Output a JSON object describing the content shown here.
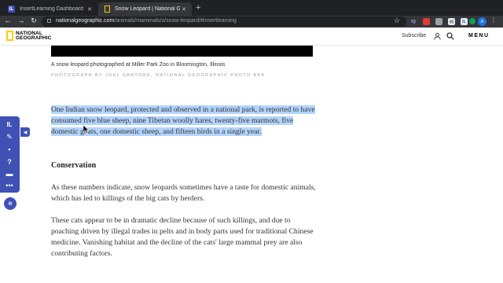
{
  "browser": {
    "tabs": [
      {
        "title": "InsertLearning Dashboard",
        "favicon": "IL",
        "active": false
      },
      {
        "title": "Snow Leopard | National Geographic",
        "favicon": "natgeo-logo-icon",
        "active": true
      }
    ],
    "new_tab_label": "+",
    "url_host": "nationalgeographic.com",
    "url_path": "/animals/mammals/s/snow-leopard/#insertlearning",
    "extensions": [
      {
        "name": "iq-extension-icon",
        "label": "IQ",
        "color": "#5b8def"
      },
      {
        "name": "red-extension-icon",
        "label": "●",
        "color": "#e53935"
      },
      {
        "name": "grey-extension-icon",
        "label": "▪",
        "color": "#5f6368"
      },
      {
        "name": "docs-extension-icon",
        "label": "▤",
        "color": "#5f6368"
      },
      {
        "name": "insertlearning-extension-icon",
        "label": "IL",
        "color": "#3f51b5"
      },
      {
        "name": "green-extension-icon",
        "label": "G",
        "color": "#0f9d58"
      },
      {
        "name": "puzzle-extension-icon",
        "label": "◆",
        "color": "#5f6368"
      }
    ],
    "profile_initial": "A"
  },
  "site": {
    "logo_line1": "NATIONAL",
    "logo_line2": "GEOGRAPHIC",
    "subscribe": "Subscribe",
    "menu": "MENU"
  },
  "article": {
    "caption": "A snow leopard photographed at Miller Park Zoo in Bloomington, Illinois",
    "credit": "PHOTOGRAPH BY JOEL SARTORE, NATIONAL GEOGRAPHIC PHOTO ARK",
    "highlighted_paragraph": "One Indian snow leopard, protected and observed in a national park, is reported to have consumed five blue sheep, nine Tibetan woolly hares, twenty-five marmots, five domestic goats, one domestic sheep, and fifteen birds in a single year.",
    "section_heading": "Conservation",
    "paragraph_2": "As these numbers indicate, snow leopards sometimes have a taste for domestic animals, which has led to killings of the big cats by herders.",
    "paragraph_3": "These cats appear to be in dramatic decline because of such killings, and due to poaching driven by illegal trades in pelts and in body parts used for traditional Chinese medicine. Vanishing habitat and the decline of the cats' large mammal prey are also contributing factors."
  },
  "insertlearning_toolbar": {
    "tools": [
      "insertlearning-logo-icon",
      "highlighter-icon",
      "sticky-note-icon",
      "question-icon",
      "discussion-icon",
      "more-icon"
    ],
    "accent_color": "#3f51b5",
    "highlight_color": "#b3d4fc"
  }
}
